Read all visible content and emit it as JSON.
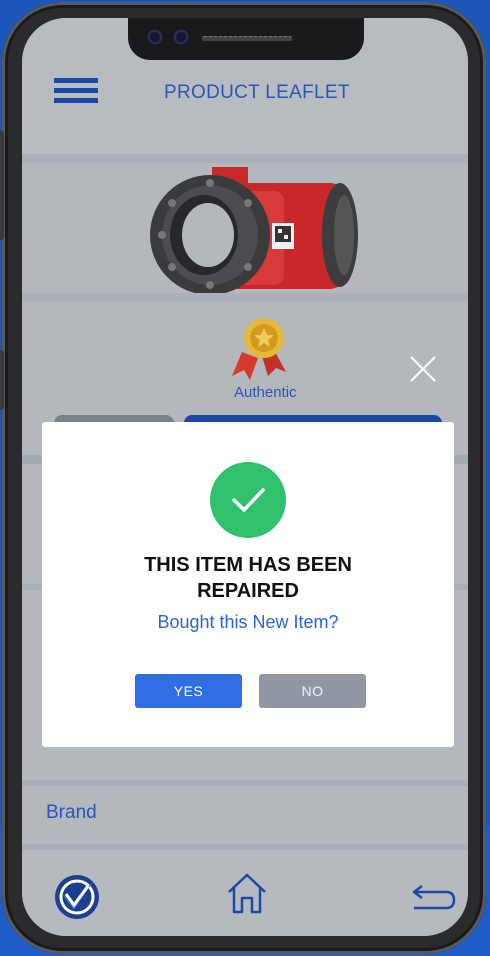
{
  "header": {
    "title": "PRODUCT LEAFLET"
  },
  "authenticity": {
    "label": "Authentic"
  },
  "details": {
    "brand_label": "Brand"
  },
  "modal": {
    "title_line1": "THIS ITEM HAS BEEN",
    "title_line2": "REPAIRED",
    "subtitle": "Bought this New Item?",
    "yes_label": "YES",
    "no_label": "NO"
  },
  "icons": {
    "menu": "hamburger-icon",
    "close": "close-icon",
    "check": "check-icon",
    "medal": "medal-icon",
    "home": "home-icon",
    "back": "back-arrow-icon",
    "logo": "brand-logo"
  },
  "colors": {
    "accent_blue": "#2f6de4",
    "title_blue": "#2a56b5",
    "success_green": "#2fc16c",
    "no_button": "#9097a3"
  }
}
